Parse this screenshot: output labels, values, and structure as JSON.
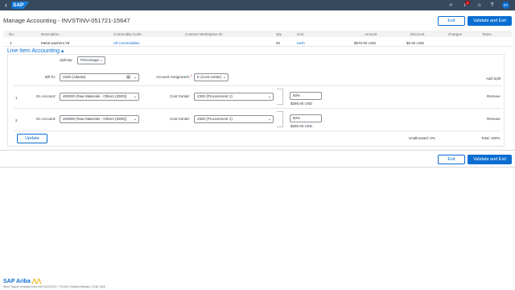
{
  "shell": {
    "back_glyph": "‹",
    "brand": "SAP",
    "icons": [
      "search-icon",
      "bell-icon",
      "cart-icon",
      "help-icon"
    ],
    "notification_count": "3",
    "user_initials": "ST"
  },
  "header": {
    "title": "Manage Accounting - INVSTINV-051721-15647",
    "exit_label": "Exit",
    "validate_label": "Validate and Exit"
  },
  "table": {
    "columns": [
      "No.",
      "Description",
      "Commodity Code",
      "Contract Workspace ID",
      "Qty",
      "Unit",
      "Amount",
      "Discount",
      "Charges",
      "Taxes"
    ],
    "rows": [
      {
        "no": "1",
        "description": "Metal washers #8",
        "commodity": "All Commodities",
        "contract": "",
        "qty": "20",
        "unit": "each",
        "amount": "$570.00 USD",
        "discount": "$0.00 USD",
        "charges": "",
        "taxes": ""
      }
    ]
  },
  "accounting": {
    "section_title": "Line Item Accounting ▴",
    "split_by_label": "Split By:",
    "split_by_value": "Percentage",
    "bill_to_label": "Bill To:",
    "bill_to_value": "3200 (Atlanta)",
    "account_assignment_label": "Account Assignment:",
    "account_assignment_value": "K (Cost center)",
    "add_split_label": "Add Split",
    "splits": [
      {
        "index": "1",
        "gl_label": "GL Account:",
        "gl_value": "400000 (Raw Materials - Others (3000))",
        "cc_label": "Cost Center:",
        "cc_value": "2300 (Procurement 1)",
        "percent": "50%",
        "amount": "$285.00 USD",
        "remove_label": "Remove"
      },
      {
        "index": "2",
        "gl_label": "GL Account:",
        "gl_value": "400000 (Raw Materials - Others (3000))",
        "cc_label": "Cost Center:",
        "cc_value": "3300 (Procurement 1)",
        "percent": "50%",
        "amount": "$285.00 USD",
        "remove_label": "Remove"
      }
    ],
    "update_label": "Update",
    "unallocated": "Unallocated: 0%",
    "total": "Total: 100%"
  },
  "footer": {
    "exit_label": "Exit",
    "validate_label": "Validate and Exit",
    "brand": "SAP Ariba",
    "small_text": "Store Tapper (snapped last edit 11/24/2021 7:33 AM | Sinskia Atlanta | C138_UAA"
  }
}
